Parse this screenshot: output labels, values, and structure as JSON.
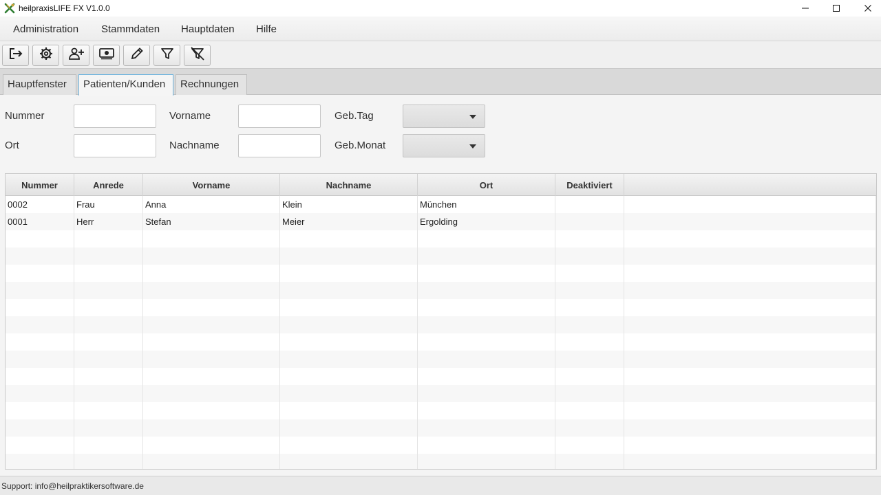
{
  "window": {
    "title": "heilpraxisLIFE FX V1.0.0",
    "controls": [
      "minimize-icon",
      "maximize-icon",
      "close-icon"
    ]
  },
  "menu": {
    "items": [
      "Administration",
      "Stammdaten",
      "Hauptdaten",
      "Hilfe"
    ]
  },
  "toolbar": {
    "buttons": [
      "logout-icon",
      "settings-gear-icon",
      "add-user-icon",
      "cash-icon",
      "edit-pencil-icon",
      "filter-icon",
      "clear-filter-icon"
    ]
  },
  "tabs": [
    {
      "label": "Hauptfenster",
      "active": false
    },
    {
      "label": "Patienten/Kunden",
      "active": true
    },
    {
      "label": "Rechnungen",
      "active": false
    }
  ],
  "filters": {
    "nummer_label": "Nummer",
    "nummer_value": "",
    "ort_label": "Ort",
    "ort_value": "",
    "vorname_label": "Vorname",
    "vorname_value": "",
    "nachname_label": "Nachname",
    "nachname_value": "",
    "gebtag_label": "Geb.Tag",
    "gebtag_value": "",
    "gebmonat_label": "Geb.Monat",
    "gebmonat_value": ""
  },
  "table": {
    "columns": [
      "Nummer",
      "Anrede",
      "Vorname",
      "Nachname",
      "Ort",
      "Deaktiviert"
    ],
    "rows": [
      [
        "0002",
        "Frau",
        "Anna",
        "Klein",
        "München",
        ""
      ],
      [
        "0001",
        "Herr",
        "Stefan",
        "Meier",
        "Ergolding",
        ""
      ]
    ]
  },
  "status": {
    "text": "Support: info@heilpraktikersoftware.de"
  },
  "colors": {
    "active_tab_border": "#6fb4de",
    "logo_primary": "#2e7d32",
    "logo_secondary": "#c8a23a"
  }
}
